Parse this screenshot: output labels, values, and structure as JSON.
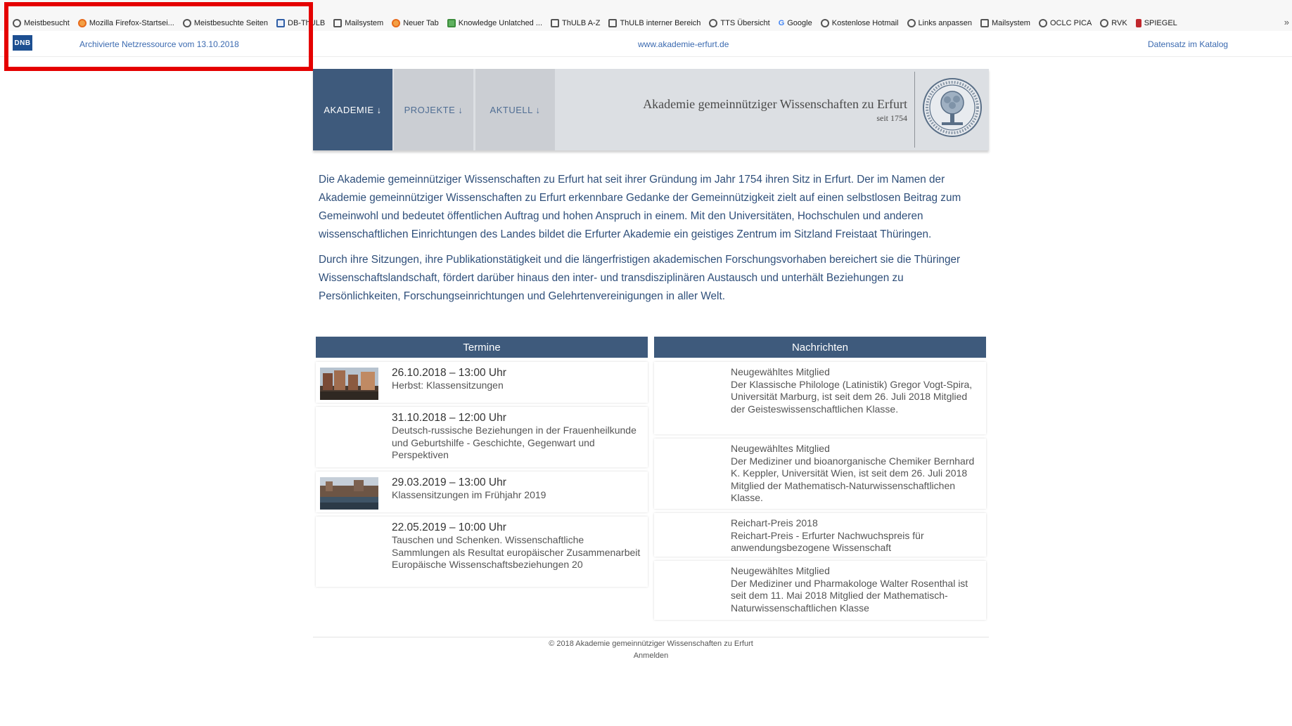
{
  "bookmarks": [
    {
      "label": "Meistbesucht",
      "icon": "gear-icon"
    },
    {
      "label": "Mozilla Firefox-Startsei...",
      "icon": "firefox-icon"
    },
    {
      "label": "Meistbesuchte Seiten",
      "icon": "gear-icon"
    },
    {
      "label": "DB-ThULB",
      "icon": "database-icon"
    },
    {
      "label": "Mailsystem",
      "icon": "mail-icon"
    },
    {
      "label": "Neuer Tab",
      "icon": "firefox-icon"
    },
    {
      "label": "Knowledge Unlatched ...",
      "icon": "book-icon"
    },
    {
      "label": "ThULB A-Z",
      "icon": "library-icon"
    },
    {
      "label": "ThULB interner Bereich",
      "icon": "library-icon"
    },
    {
      "label": "TTS Übersicht",
      "icon": "globe-icon"
    },
    {
      "label": "Google",
      "icon": "google-icon"
    },
    {
      "label": "Kostenlose Hotmail",
      "icon": "globe-icon"
    },
    {
      "label": "Links anpassen",
      "icon": "globe-icon"
    },
    {
      "label": "Mailsystem",
      "icon": "mail-icon"
    },
    {
      "label": "OCLC PICA",
      "icon": "globe-icon"
    },
    {
      "label": "RVK",
      "icon": "globe-icon"
    },
    {
      "label": "SPIEGEL",
      "icon": "spiegel-icon"
    }
  ],
  "bookmarks_overflow": "»",
  "archive": {
    "logo_text": "DNB",
    "archived_label": "Archivierte Netzressource vom 13.10.2018",
    "url": "www.akademie-erfurt.de",
    "catalog_link": "Datensatz im Katalog"
  },
  "header": {
    "nav": [
      "AKADEMIE ↓",
      "PROJEKTE ↓",
      "AKTUELL ↓"
    ],
    "title": "Akademie gemeinnütziger Wissenschaften zu Erfurt",
    "since": "seit 1754"
  },
  "intro": [
    "Die Akademie gemeinnütziger Wissenschaften zu Erfurt hat seit ihrer Gründung im Jahr 1754 ihren Sitz in Erfurt. Der im Namen der Akademie gemeinnütziger Wissenschaften zu Erfurt erkennbare Gedanke der Gemeinnützigkeit zielt auf einen selbstlosen Beitrag zum Gemeinwohl und bedeutet öffentlichen Auftrag und hohen Anspruch in einem. Mit den Universitäten, Hochschulen und anderen wissenschaftlichen Einrichtungen des Landes bildet die Erfurter Akademie ein geistiges Zentrum im Sitzland Freistaat Thüringen.",
    "Durch ihre Sitzungen, ihre Publikationstätigkeit und die längerfristigen akademischen Forschungsvorhaben bereichert sie die Thüringer Wissenschaftslandschaft, fördert darüber hinaus den inter- und transdisziplinären Austausch und unterhält Beziehungen zu Persönlichkeiten, Forschungseinrichtungen und Gelehrtenvereinigungen in aller Welt."
  ],
  "termine": {
    "heading": "Termine",
    "items": [
      {
        "date": "26.10.2018 – 13:00 Uhr",
        "desc": "Herbst: Klassensitzungen",
        "image": true
      },
      {
        "date": "31.10.2018 – 12:00 Uhr",
        "desc": "Deutsch-russische Beziehungen in der Frauenheilkunde und Geburtshilfe - Geschichte, Gegenwart und Perspektiven",
        "image": false
      },
      {
        "date": "29.03.2019 – 13:00 Uhr",
        "desc": "Klassensitzungen im Frühjahr 2019",
        "image": true
      },
      {
        "date": "22.05.2019 – 10:00 Uhr",
        "desc": "Tauschen und Schenken. Wissenschaftliche Sammlungen als Resultat europäischer Zusammenarbeit\nEuropäische Wissenschaftsbeziehungen 20",
        "image": false
      }
    ]
  },
  "nachrichten": {
    "heading": "Nachrichten",
    "items": [
      {
        "title": "Neugewähltes Mitglied",
        "text": "Der Klassische Philologe (Latinistik) Gregor Vogt-Spira, Universität Marburg, ist seit dem 26. Juli 2018 Mitglied der Geisteswissenschaftlichen Klasse."
      },
      {
        "title": "Neugewähltes Mitglied",
        "text": "Der Mediziner und bioanorganische Chemiker Bernhard K. Keppler, Universität Wien, ist seit dem 26. Juli 2018 Mitglied der Mathematisch-Naturwissenschaftlichen Klasse."
      },
      {
        "title": "Reichart-Preis 2018",
        "text": "Reichart-Preis - Erfurter Nachwuchspreis für anwendungsbezogene Wissenschaft"
      },
      {
        "title": "Neugewähltes Mitglied",
        "text": "Der Mediziner und Pharmakologe Walter Rosenthal ist seit dem 11. Mai 2018 Mitglied der Mathematisch-Naturwissenschaftlichen Klasse"
      }
    ]
  },
  "footer": {
    "copyright": "© 2018 Akademie gemeinnütziger Wissenschaften zu Erfurt",
    "login": "Anmelden"
  },
  "colors": {
    "nav_active": "#3e5a7c",
    "header_bg": "#dcdfe3",
    "link": "#3b6ab0",
    "intro_text": "#2f4f7a",
    "highlight": "#e50000"
  }
}
